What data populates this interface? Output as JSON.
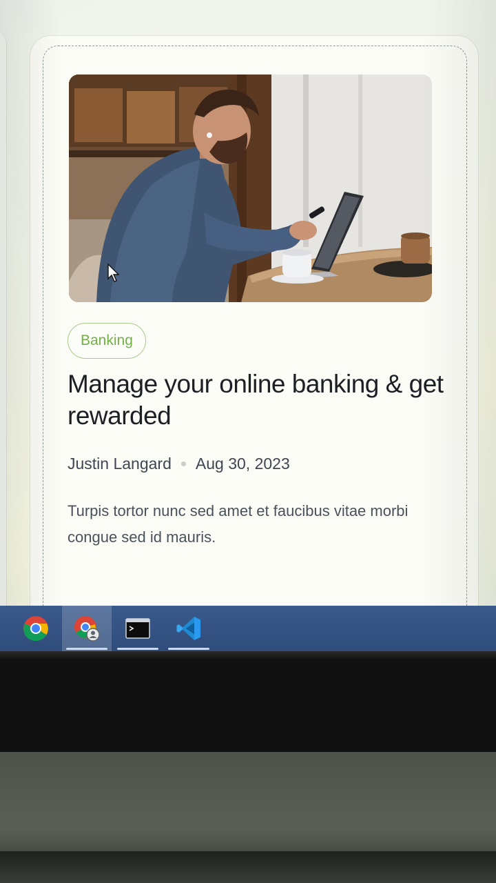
{
  "article": {
    "category": "Banking",
    "title": "Manage your online banking & get rewarded",
    "author": "Justin Langard",
    "date": "Aug 30, 2023",
    "excerpt": "Turpis tortor nunc sed amet et faucibus vitae morbi congue sed id mauris.",
    "image": "man-using-phone-at-laptop-photo"
  },
  "taskbar": {
    "apps": [
      {
        "icon": "chrome-icon",
        "active": false
      },
      {
        "icon": "chrome-profile-icon",
        "active": true
      },
      {
        "icon": "terminal-icon",
        "active": false
      },
      {
        "icon": "vscode-icon",
        "active": false
      }
    ]
  },
  "colors": {
    "accent_green": "#72b046",
    "chip_border": "#a9c98a",
    "title": "#1c1f24",
    "taskbar": "#34547f",
    "vscode_blue": "#2a9af0"
  }
}
